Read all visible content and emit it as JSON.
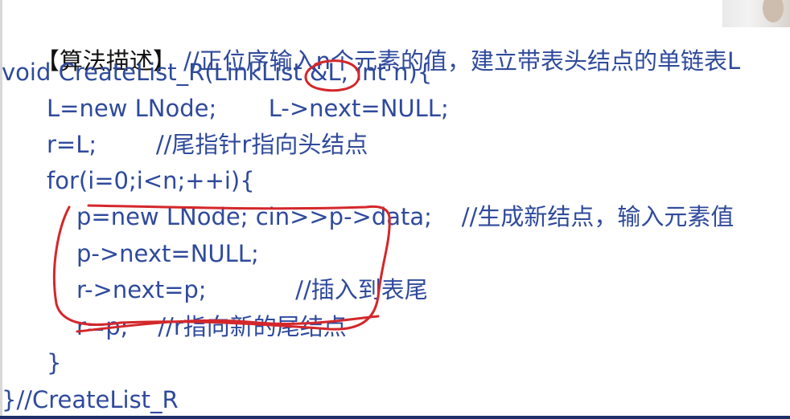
{
  "lines": {
    "l1": {
      "bracket": "【算法描述】",
      "comment": "//正位序输入n个元素的值，建立带表头结点的单链表L"
    },
    "l2": {
      "code": "void CreateList_R(LinkList &L, int n){"
    },
    "l3": {
      "code": "L=new LNode;       L->next=NULL;"
    },
    "l4": {
      "code": "r=L;        //尾指针r指向头结点"
    },
    "l5": {
      "code": "for(i=0;i<n;++i){"
    },
    "l6": {
      "code": "p=new LNode; cin>>p->data;    //生成新结点，输入元素值"
    },
    "l7": {
      "code": "p->next=NULL;"
    },
    "l8": {
      "code": "r->next=p;            //插入到表尾"
    },
    "l9": {
      "code": "r=p;    //r指向新的尾结点"
    },
    "l10": {
      "code": "}"
    },
    "l11": {
      "code": "}//CreateList_R"
    }
  },
  "annotation_color": "#d4272b"
}
